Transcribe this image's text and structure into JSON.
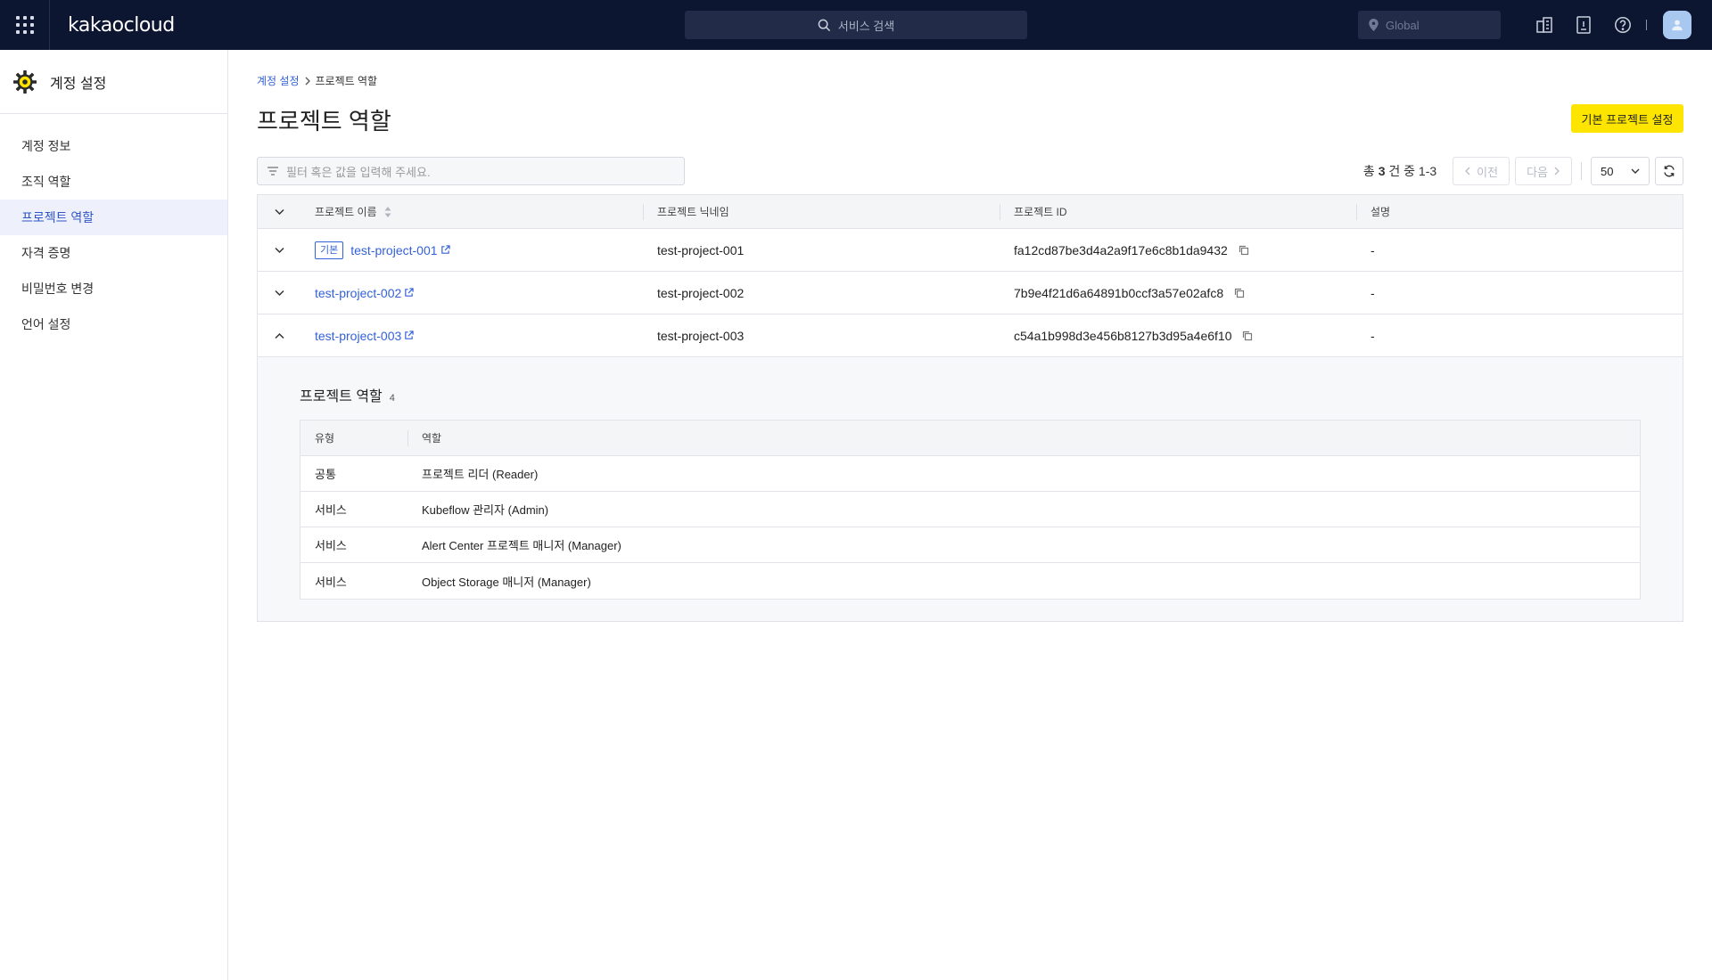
{
  "topbar": {
    "logo_text": "kakaocloud",
    "search_placeholder": "서비스 검색",
    "region": "Global"
  },
  "sidebar": {
    "title": "계정 설정",
    "items": [
      {
        "label": "계정 정보"
      },
      {
        "label": "조직 역할"
      },
      {
        "label": "프로젝트 역할"
      },
      {
        "label": "자격 증명"
      },
      {
        "label": "비밀번호 변경"
      },
      {
        "label": "언어 설정"
      }
    ]
  },
  "main": {
    "breadcrumb": {
      "parent": "계정 설정",
      "current": "프로젝트 역할"
    },
    "title": "프로젝트 역할",
    "primary_button": "기본 프로젝트 설정",
    "filter_placeholder": "필터 혹은 값을 입력해 주세요.",
    "pager": {
      "prefix": "총",
      "count": "3",
      "suffix": "건 중",
      "range": "1-3",
      "prev": "이전",
      "next": "다음",
      "page_size": "50"
    },
    "table": {
      "headers": {
        "name": "프로젝트 이름",
        "nickname": "프로젝트 닉네임",
        "id": "프로젝트 ID",
        "desc": "설명"
      },
      "rows": [
        {
          "badge": "기본",
          "name": "test-project-001",
          "nickname": "test-project-001",
          "id": "fa12cd87be3d4a2a9f17e6c8b1da9432",
          "desc": "-"
        },
        {
          "name": "test-project-002",
          "nickname": "test-project-002",
          "id": "7b9e4f21d6a64891b0ccf3a57e02afc8",
          "desc": "-"
        },
        {
          "name": "test-project-003",
          "nickname": "test-project-003",
          "id": "c54a1b998d3e456b8127b3d95a4e6f10",
          "desc": "-"
        }
      ]
    },
    "expanded": {
      "title": "프로젝트 역할",
      "count": "4",
      "headers": {
        "type": "유형",
        "role": "역할"
      },
      "rows": [
        {
          "type": "공통",
          "role": "프로젝트 리더 (Reader)"
        },
        {
          "type": "서비스",
          "role": "Kubeflow 관리자 (Admin)"
        },
        {
          "type": "서비스",
          "role": "Alert Center 프로젝트 매니저 (Manager)"
        },
        {
          "type": "서비스",
          "role": "Object Storage 매니저 (Manager)"
        }
      ]
    }
  },
  "colors": {
    "topbar": "#0d1630",
    "accent": "#3361d8",
    "primary_button": "#fee500"
  },
  "icons": [
    "apps-grid-icon",
    "search-icon",
    "location-pin-icon",
    "building-icon",
    "id-card-icon",
    "help-icon",
    "user-icon",
    "gear-icon",
    "filter-icon",
    "sort-icon",
    "external-link-icon",
    "copy-icon",
    "chevron-down-icon",
    "chevron-up-icon",
    "chevron-left-icon",
    "chevron-right-icon",
    "refresh-icon"
  ]
}
